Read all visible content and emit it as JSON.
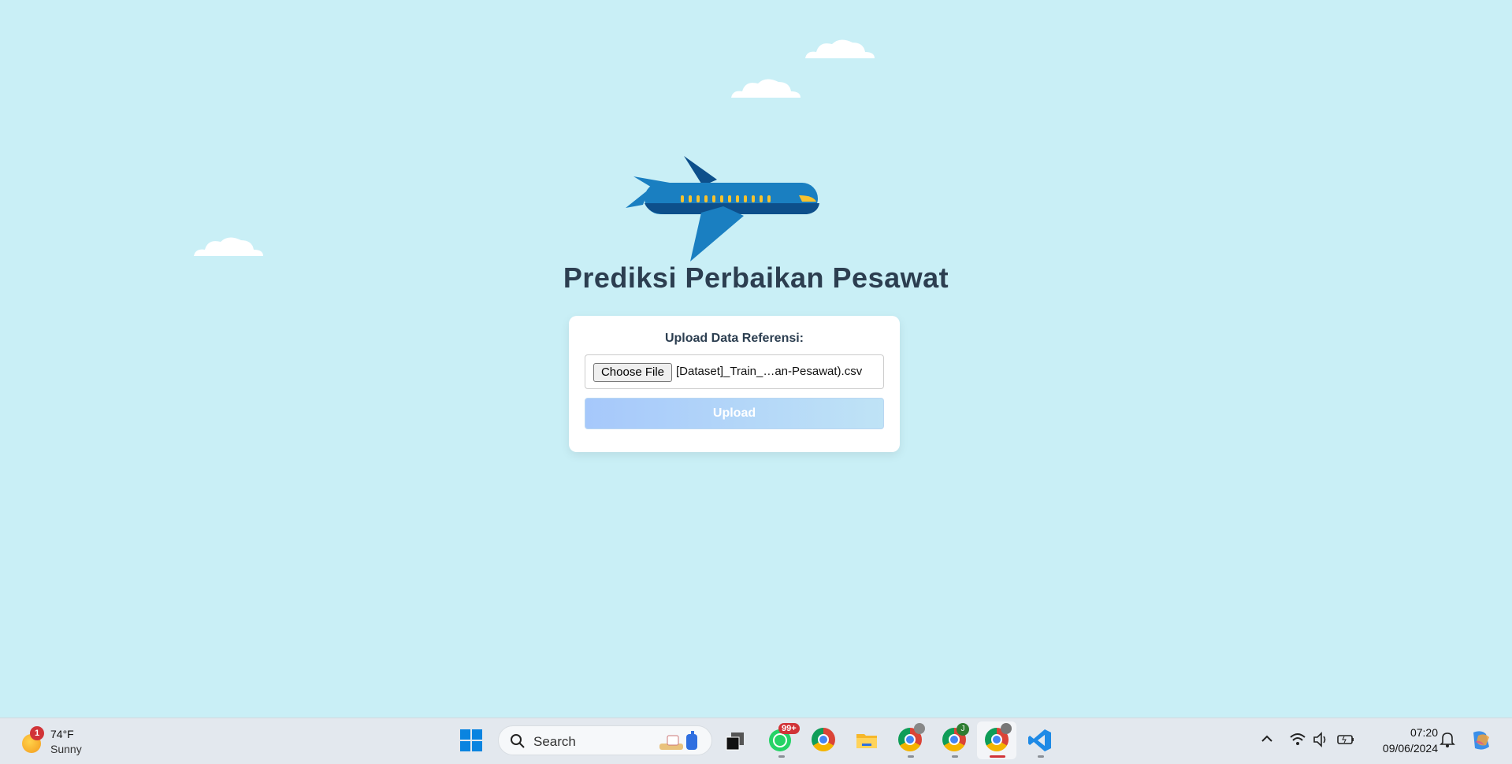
{
  "page": {
    "title": "Prediksi Perbaikan Pesawat"
  },
  "upload_form": {
    "label": "Upload Data Referensi:",
    "choose_file_label": "Choose File",
    "file_name": "[Dataset]_Train_…an-Pesawat).csv",
    "upload_label": "Upload"
  },
  "taskbar": {
    "weather": {
      "temp": "74°F",
      "condition": "Sunny",
      "badge": "1"
    },
    "search_placeholder": "Search",
    "whatsapp_badge": "99+",
    "chrome_profile_badge": "J",
    "time": "07:20",
    "date": "09/06/2024",
    "pinned_icons": [
      "windows-start-icon",
      "task-view-icon",
      "whatsapp-icon",
      "chrome-icon",
      "file-explorer-icon",
      "chrome-profile-icon",
      "chrome-profile-j-icon",
      "chrome-active-icon",
      "vscode-icon"
    ]
  },
  "colors": {
    "background": "#c9eff6",
    "title": "#2c3e50",
    "plane_body": "#1a7fc1",
    "plane_dark": "#0d4f8b",
    "window_lights": "#f7c22e"
  }
}
